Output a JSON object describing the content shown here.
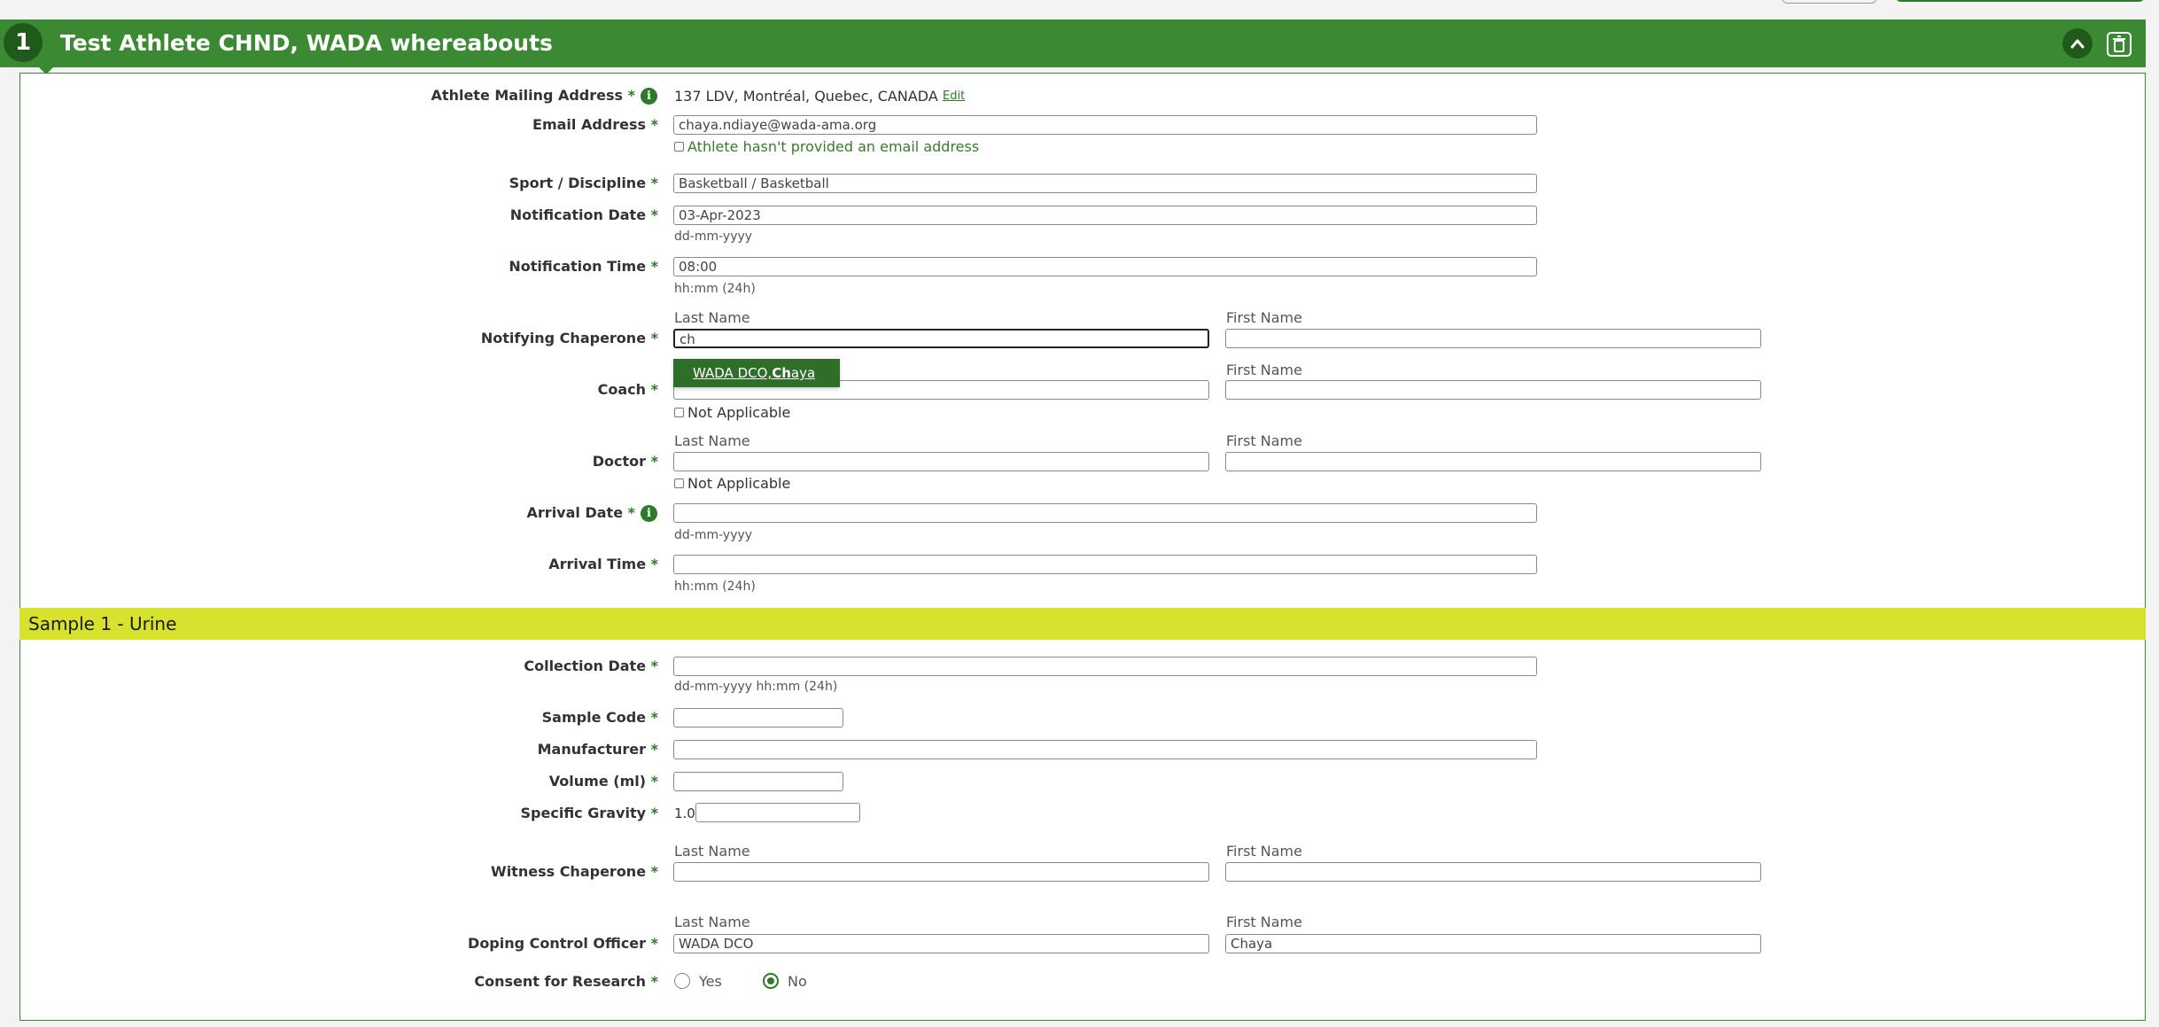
{
  "header": {
    "step_number": "1",
    "title": "Test Athlete CHND, WADA whereabouts"
  },
  "req_mark": "*",
  "labels": {
    "mailing_address": "Athlete Mailing Address",
    "email": "Email Address",
    "sport": "Sport / Discipline",
    "notification_date": "Notification Date",
    "notification_time": "Notification Time",
    "notifying_chaperone": "Notifying Chaperone",
    "coach": "Coach",
    "doctor": "Doctor",
    "arrival_date": "Arrival Date",
    "arrival_time": "Arrival Time",
    "collection_date": "Collection Date",
    "sample_code": "Sample Code",
    "manufacturer": "Manufacturer",
    "volume": "Volume (ml)",
    "specific_gravity": "Specific Gravity",
    "witness_chaperone": "Witness Chaperone",
    "dco": "Doping Control Officer",
    "consent": "Consent for Research"
  },
  "values": {
    "mailing_address": "137 LDV, Montréal, Quebec, CANADA",
    "edit_link": "Edit",
    "email": "chaya.ndiaye@wada-ama.org",
    "no_email": "Athlete hasn't provided an email address",
    "sport": "Basketball / Basketball",
    "notification_date": "03-Apr-2023",
    "notification_time": "08:00",
    "notifying_chaperone_last": "ch",
    "coach_not_applicable": "Not Applicable",
    "doctor_not_applicable": "Not Applicable",
    "specific_gravity_prefix": "1.0",
    "dco_last": "WADA DCO",
    "dco_first": "Chaya"
  },
  "hints": {
    "date": "dd-mm-yyyy",
    "time": "hh:mm (24h)",
    "datetime": "dd-mm-yyyy hh:mm (24h)"
  },
  "sublabels": {
    "last_name": "Last Name",
    "first_name": "First Name"
  },
  "autocomplete": {
    "prefix": "WADA DCO, ",
    "match": "Ch",
    "suffix": "aya"
  },
  "section": {
    "title": "Sample 1 - Urine"
  },
  "consent": {
    "yes": "Yes",
    "no": "No",
    "selected": "No"
  },
  "colors": {
    "primary_green": "#3b8a33",
    "dark_green": "#1f5a1b",
    "section_yellow": "#d6e22d"
  },
  "icons": {
    "info": "info-icon",
    "collapse": "chevron-up-icon",
    "delete": "trash-icon"
  }
}
